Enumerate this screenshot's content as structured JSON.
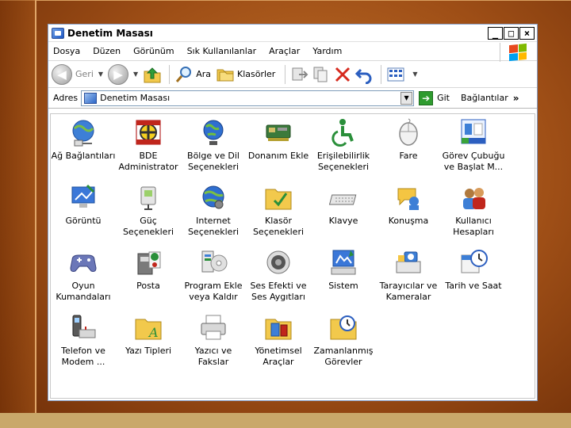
{
  "window": {
    "title": "Denetim Masası",
    "buttons": [
      "_",
      "□",
      "×"
    ]
  },
  "menu": [
    "Dosya",
    "Düzen",
    "Görünüm",
    "Sık Kullanılanlar",
    "Araçlar",
    "Yardım"
  ],
  "toolbar": {
    "back_label": "Geri",
    "search_label": "Ara",
    "folders_label": "Klasörler"
  },
  "address": {
    "label": "Adres",
    "value": "Denetim Masası",
    "go_label": "Git",
    "links_label": "Bağlantılar",
    "links_chevron": "»"
  },
  "items": [
    {
      "label": "Ağ Bağlantıları",
      "icon": "network-connections-icon"
    },
    {
      "label": "BDE\nAdministrator",
      "icon": "bde-administrator-icon"
    },
    {
      "label": "Bölge ve Dil\nSeçenekleri",
      "icon": "regional-language-icon"
    },
    {
      "label": "Donanım Ekle",
      "icon": "add-hardware-icon"
    },
    {
      "label": "Erişilebilirlik\nSeçenekleri",
      "icon": "accessibility-icon"
    },
    {
      "label": "Fare",
      "icon": "mouse-icon"
    },
    {
      "label": "Görev Çubuğu\nve Başlat M...",
      "icon": "taskbar-start-menu-icon"
    },
    {
      "label": "Görüntü",
      "icon": "display-icon"
    },
    {
      "label": "Güç\nSeçenekleri",
      "icon": "power-options-icon"
    },
    {
      "label": "Internet\nSeçenekleri",
      "icon": "internet-options-icon"
    },
    {
      "label": "Klasör\nSeçenekleri",
      "icon": "folder-options-icon"
    },
    {
      "label": "Klavye",
      "icon": "keyboard-icon"
    },
    {
      "label": "Konuşma",
      "icon": "speech-icon"
    },
    {
      "label": "Kullanıcı\nHesapları",
      "icon": "user-accounts-icon"
    },
    {
      "label": "Oyun\nKumandaları",
      "icon": "game-controllers-icon"
    },
    {
      "label": "Posta",
      "icon": "mail-icon"
    },
    {
      "label": "Program Ekle\nveya Kaldır",
      "icon": "add-remove-programs-icon"
    },
    {
      "label": "Ses Efekti ve\nSes Aygıtları",
      "icon": "sounds-audio-icon"
    },
    {
      "label": "Sistem",
      "icon": "system-icon"
    },
    {
      "label": "Tarayıcılar ve\nKameralar",
      "icon": "scanners-cameras-icon"
    },
    {
      "label": "Tarih ve Saat",
      "icon": "date-time-icon"
    },
    {
      "label": "Telefon ve\nModem ...",
      "icon": "phone-modem-icon"
    },
    {
      "label": "Yazı Tipleri",
      "icon": "fonts-icon"
    },
    {
      "label": "Yazıcı ve\nFakslar",
      "icon": "printers-faxes-icon"
    },
    {
      "label": "Yönetimsel\nAraçlar",
      "icon": "administrative-tools-icon"
    },
    {
      "label": "Zamanlanmış\nGörevler",
      "icon": "scheduled-tasks-icon"
    }
  ],
  "colors": {
    "slide_bg": "#a35419",
    "window_border": "#8aa1c9",
    "go_green": "#2f9b2f"
  }
}
